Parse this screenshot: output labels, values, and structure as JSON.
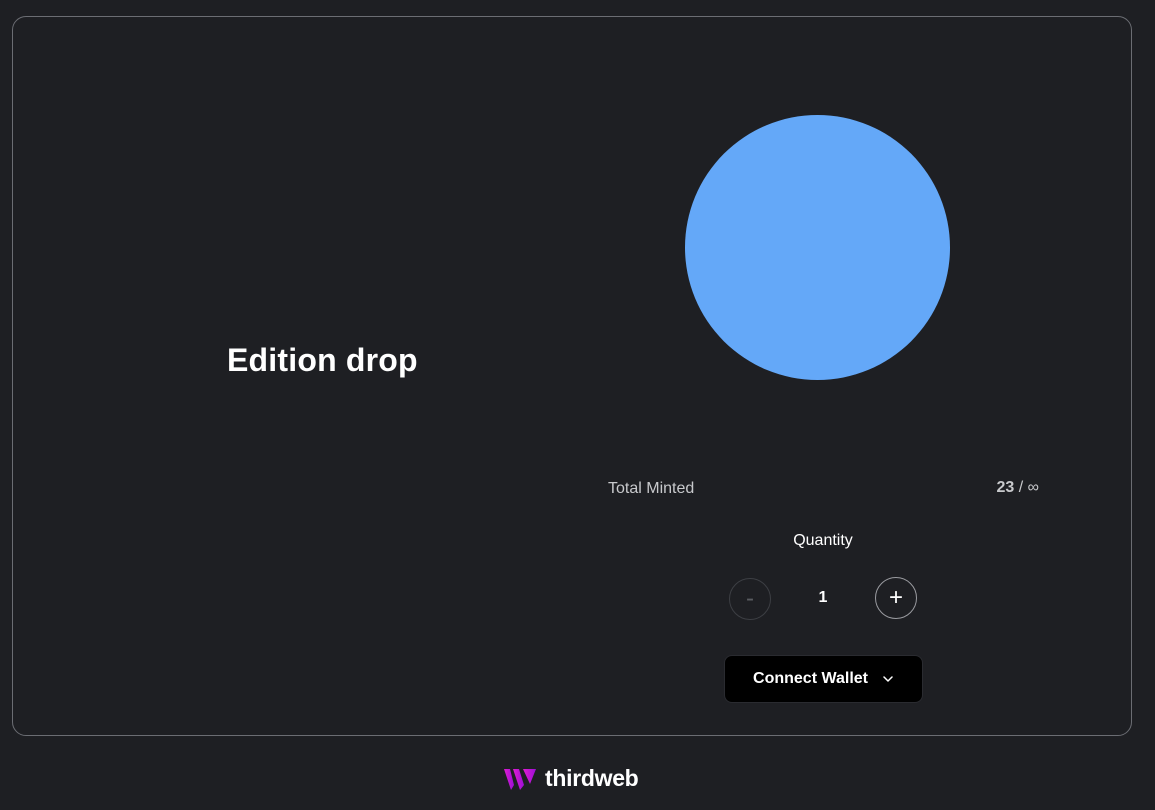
{
  "drop": {
    "title": "Edition drop",
    "image_color": "#64a8f8"
  },
  "minted": {
    "label": "Total Minted",
    "count": "23",
    "separator": "/",
    "max": "∞"
  },
  "quantity": {
    "label": "Quantity",
    "value": "1",
    "minus_label": "-",
    "plus_label": "+"
  },
  "wallet": {
    "button_label": "Connect Wallet",
    "chevron_icon": "chevron-down-icon"
  },
  "footer": {
    "brand": "thirdweb",
    "logo_icon": "thirdweb-logo-icon",
    "logo_colors": [
      "#e11cd2",
      "#9b0fd6"
    ]
  }
}
